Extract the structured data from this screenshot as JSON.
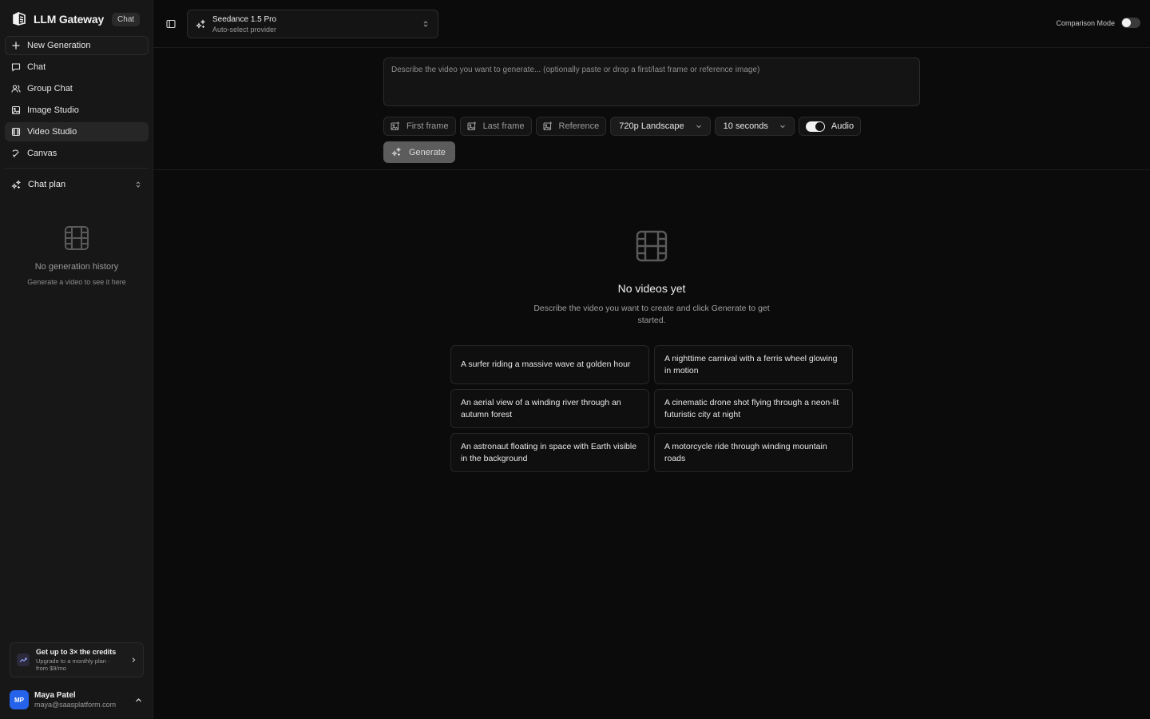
{
  "brand": {
    "name": "LLM Gateway",
    "badge": "Chat"
  },
  "nav": {
    "new_generation": "New Generation",
    "chat": "Chat",
    "group_chat": "Group Chat",
    "image_studio": "Image Studio",
    "video_studio": "Video Studio",
    "canvas": "Canvas"
  },
  "plan": {
    "label": "Chat plan"
  },
  "history": {
    "empty_title": "No generation history",
    "empty_sub": "Generate a video to see it here"
  },
  "upgrade": {
    "title": "Get up to 3× the credits",
    "subtitle": "Upgrade to a monthly plan · from $9/mo"
  },
  "user": {
    "initials": "MP",
    "name": "Maya Patel",
    "email": "maya@saasplatform.com"
  },
  "model": {
    "name": "Seedance 1.5 Pro",
    "provider": "Auto-select provider"
  },
  "comparison": {
    "label": "Comparison Mode",
    "enabled": false
  },
  "composer": {
    "placeholder": "Describe the video you want to generate... (optionally paste or drop a first/last frame or reference image)",
    "first_frame": "First frame",
    "last_frame": "Last frame",
    "reference": "Reference",
    "resolution": "720p Landscape",
    "duration": "10 seconds",
    "audio": "Audio",
    "audio_enabled": true,
    "generate": "Generate"
  },
  "empty": {
    "title": "No videos yet",
    "description": "Describe the video you want to create and click Generate to get started."
  },
  "suggestions": [
    "A surfer riding a massive wave at golden hour",
    "A nighttime carnival with a ferris wheel glowing in motion",
    "An aerial view of a winding river through an autumn forest",
    "A cinematic drone shot flying through a neon-lit futuristic city at night",
    "An astronaut floating in space with Earth visible in the background",
    "A motorcycle ride through winding mountain roads"
  ],
  "colors": {
    "avatar": "#2563eb",
    "background": "#0a0a0a",
    "sidebar": "#171717"
  }
}
